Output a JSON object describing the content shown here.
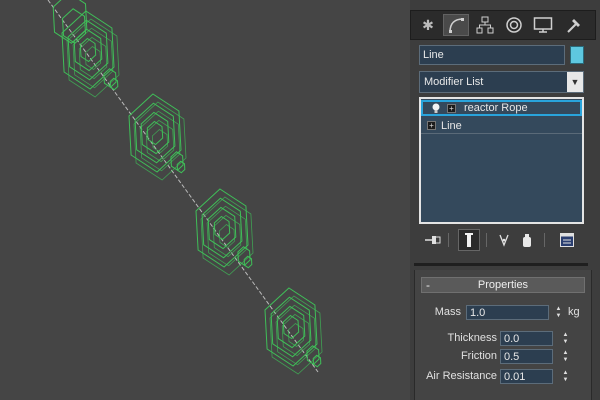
{
  "panel": {
    "tabs": [
      {
        "name": "create-tab",
        "icon": "sun-star-icon"
      },
      {
        "name": "modify-tab",
        "icon": "bend-curve-icon"
      },
      {
        "name": "hierarchy-tab",
        "icon": "hierarchy-icon"
      },
      {
        "name": "motion-tab",
        "icon": "motion-circle-icon"
      },
      {
        "name": "display-tab",
        "icon": "monitor-icon"
      },
      {
        "name": "utilities-tab",
        "icon": "hammer-icon"
      }
    ],
    "object_name": "Line",
    "object_color": "#5ec8e0",
    "modifier_list_label": "Modifier List",
    "stack": [
      {
        "label": "reactor Rope",
        "selected": true
      },
      {
        "label": "Line",
        "selected": false
      }
    ],
    "toolbar_icons": [
      "pin-stack-icon",
      "show-end-result-icon",
      "make-unique-icon",
      "remove-modifier-icon",
      "configure-modifier-sets-icon"
    ]
  },
  "properties": {
    "title": "Properties",
    "collapse_symbol": "-",
    "mass_label": "Mass",
    "mass_value": "1.0",
    "mass_unit": "kg",
    "thickness_label": "Thickness",
    "thickness_value": "0.0",
    "friction_label": "Friction",
    "friction_value": "0.5",
    "air_resistance_label": "Air Resistance",
    "air_resistance_value": "0.01"
  },
  "viewport": {
    "wire_color": "#3fbf58",
    "background": "#454545"
  }
}
